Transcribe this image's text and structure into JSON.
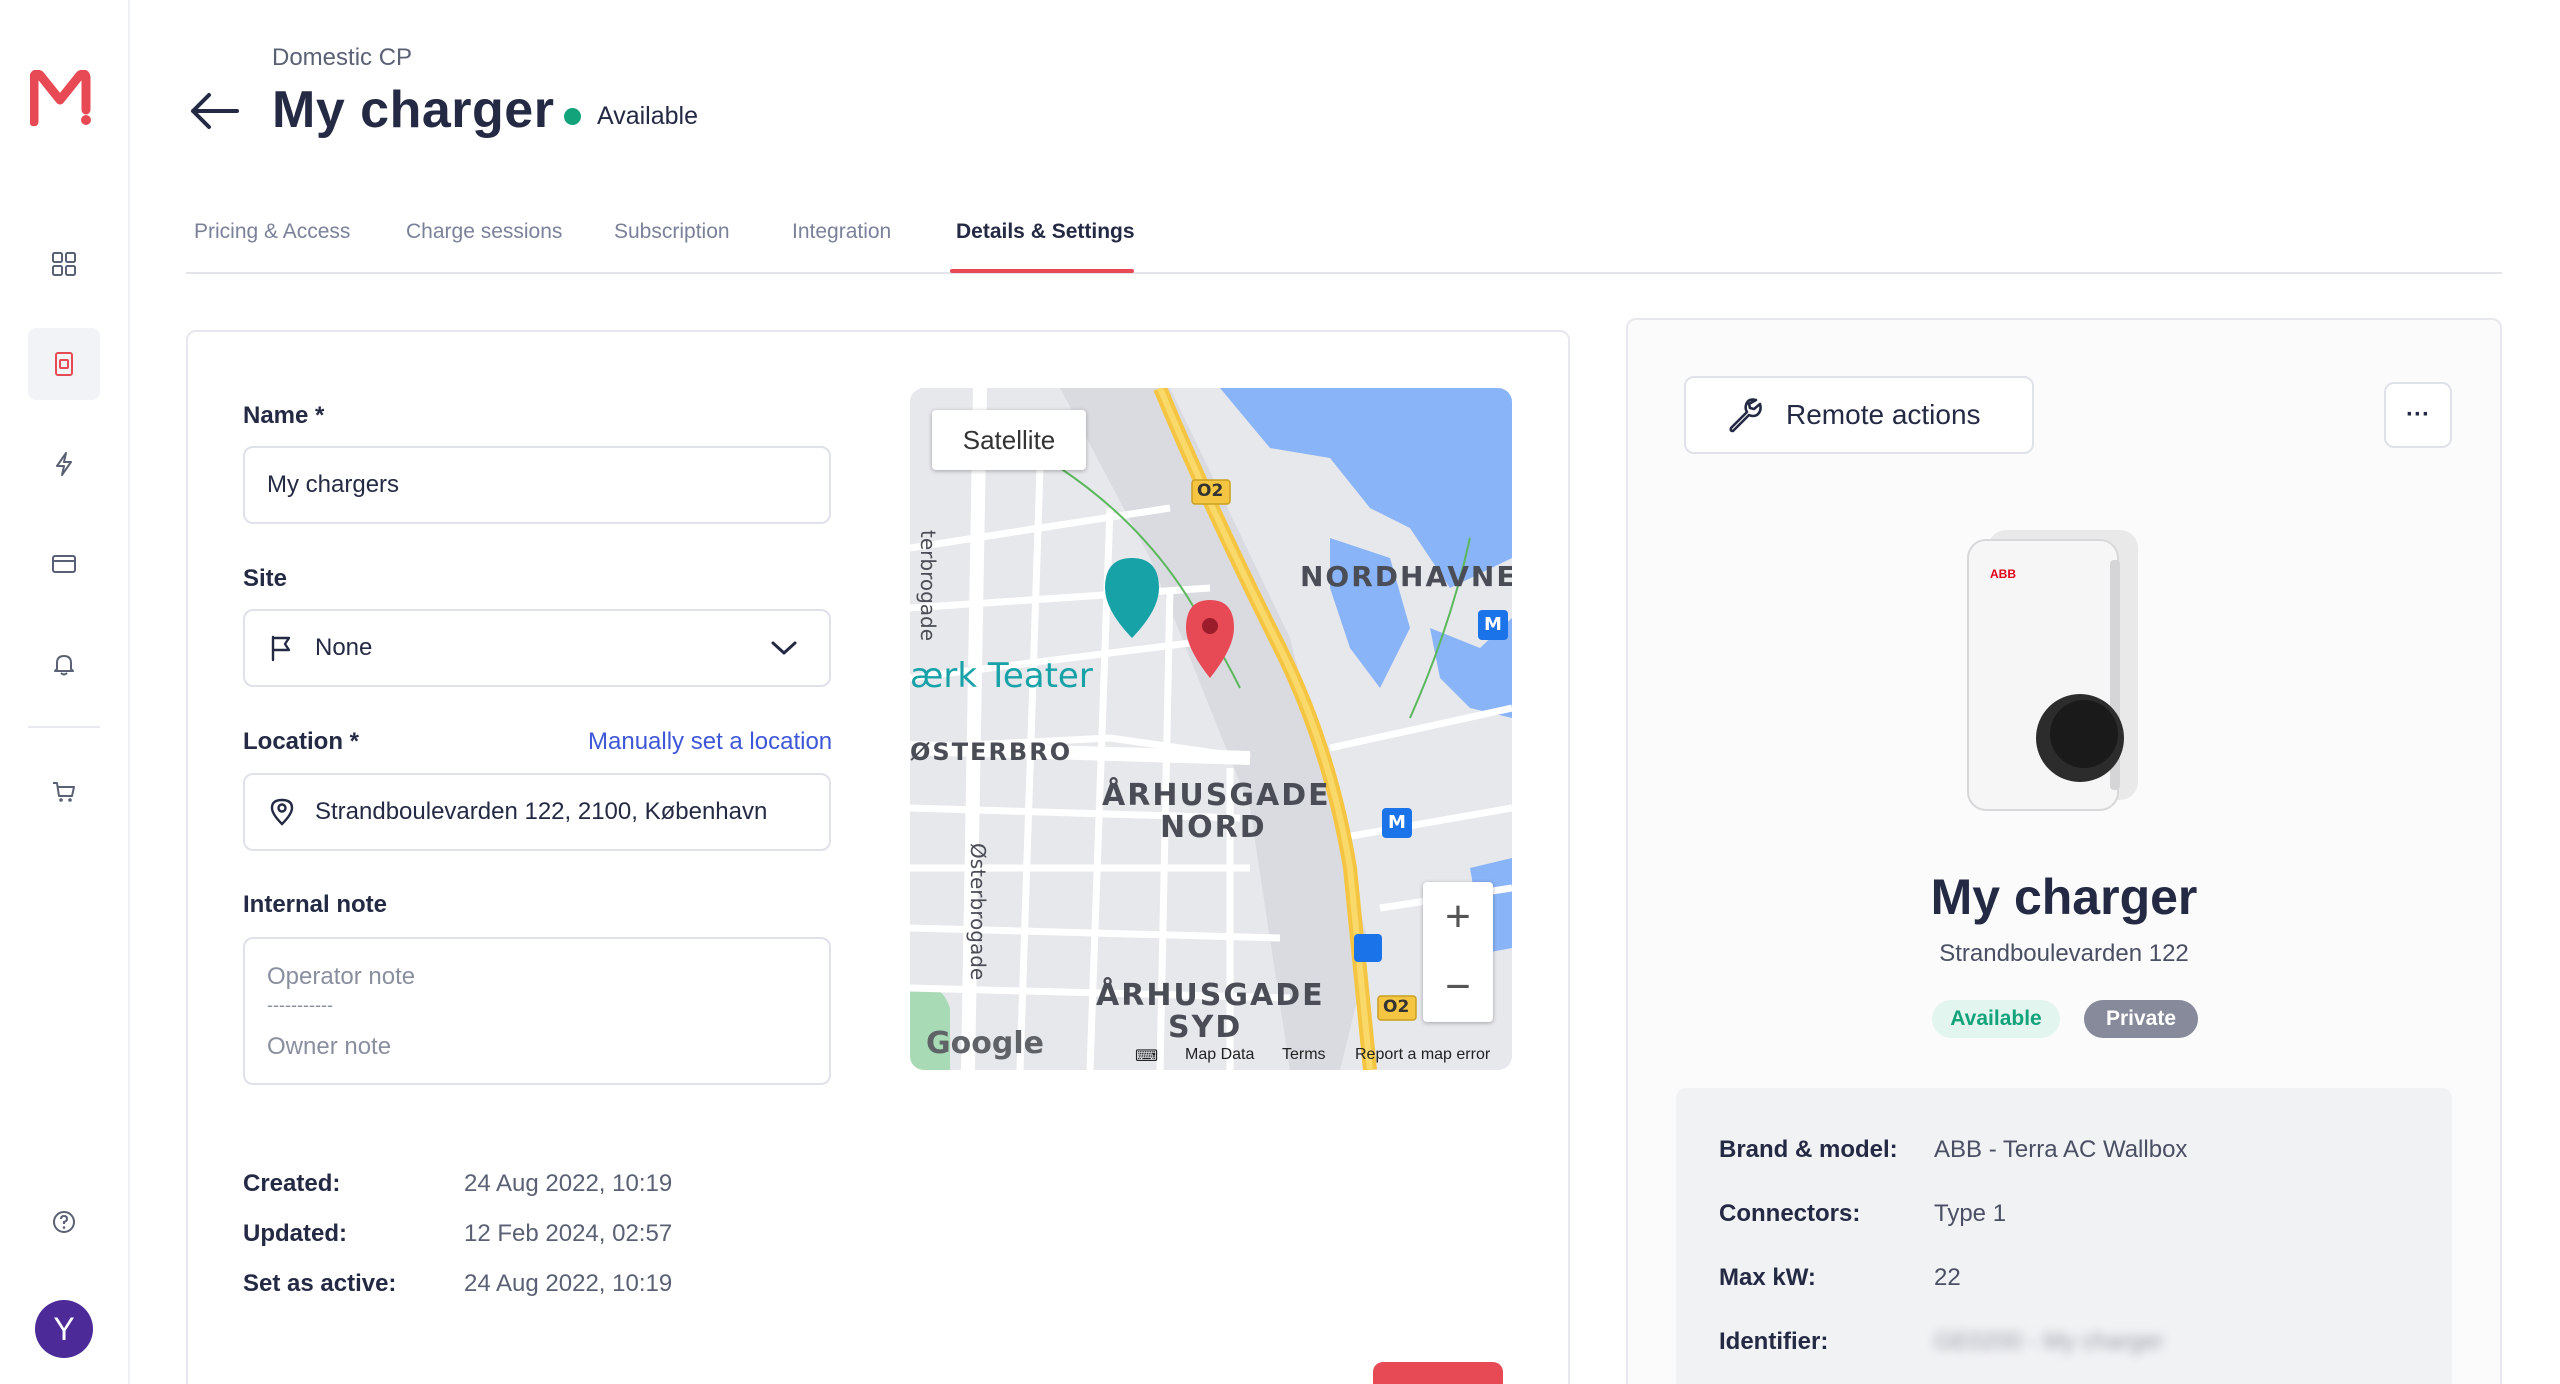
{
  "header": {
    "breadcrumb": "Domestic CP",
    "title": "My charger",
    "status": "Available"
  },
  "tabs": [
    {
      "label": "Pricing & Access"
    },
    {
      "label": "Charge sessions"
    },
    {
      "label": "Subscription"
    },
    {
      "label": "Integration"
    },
    {
      "label": "Details & Settings",
      "active": true
    }
  ],
  "form": {
    "name_label": "Name *",
    "name_value": "My chargers",
    "site_label": "Site",
    "site_value": "None",
    "location_label": "Location *",
    "location_link": "Manually set a location",
    "location_value": "Strandboulevarden 122, 2100, København",
    "note_label": "Internal note",
    "note_line1": "Operator note",
    "note_line2": "-----------",
    "note_line3": "Owner note"
  },
  "meta": {
    "created_label": "Created:",
    "created_value": "24 Aug 2022, 10:19",
    "updated_label": "Updated:",
    "updated_value": "12 Feb 2024, 02:57",
    "active_label": "Set as active:",
    "active_value": "24 Aug 2022, 10:19"
  },
  "map": {
    "satellite_label": "Satellite",
    "labels": {
      "nordhavn": "NORDHAVNE",
      "teater": "ærk Teater",
      "osterbro": "ØSTERBRO",
      "arhus_nord_1": "ÅRHUSGADE",
      "arhus_nord_2": "NORD",
      "arhus_syd_1": "ÅRHUSGADE",
      "arhus_syd_2": "SYD",
      "street_top": "terbrogade",
      "street_bottom": "Østerbrogade",
      "route_1": "O2",
      "route_2": "O2",
      "metro": "M",
      "google": "Google"
    },
    "footer": {
      "map_data": "Map Data",
      "terms": "Terms",
      "report": "Report a map error"
    },
    "zoom_in": "+",
    "zoom_out": "−"
  },
  "charger": {
    "remote_actions": "Remote actions",
    "more": "···",
    "name": "My charger",
    "address": "Strandboulevarden 122",
    "badge_available": "Available",
    "badge_private": "Private",
    "brand_label": "Brand & model:",
    "brand_value": "ABB - Terra AC Wallbox",
    "connectors_label": "Connectors:",
    "connectors_value": "Type 1",
    "max_kw_label": "Max kW:",
    "max_kw_value": "22",
    "identifier_label": "Identifier:",
    "identifier_value": "GE0200 - My charger"
  },
  "user": {
    "initial": "Y"
  },
  "colors": {
    "brand": "#e84a55",
    "available": "#13a37b",
    "link": "#3e57d8",
    "avatar": "#4c2a98"
  }
}
